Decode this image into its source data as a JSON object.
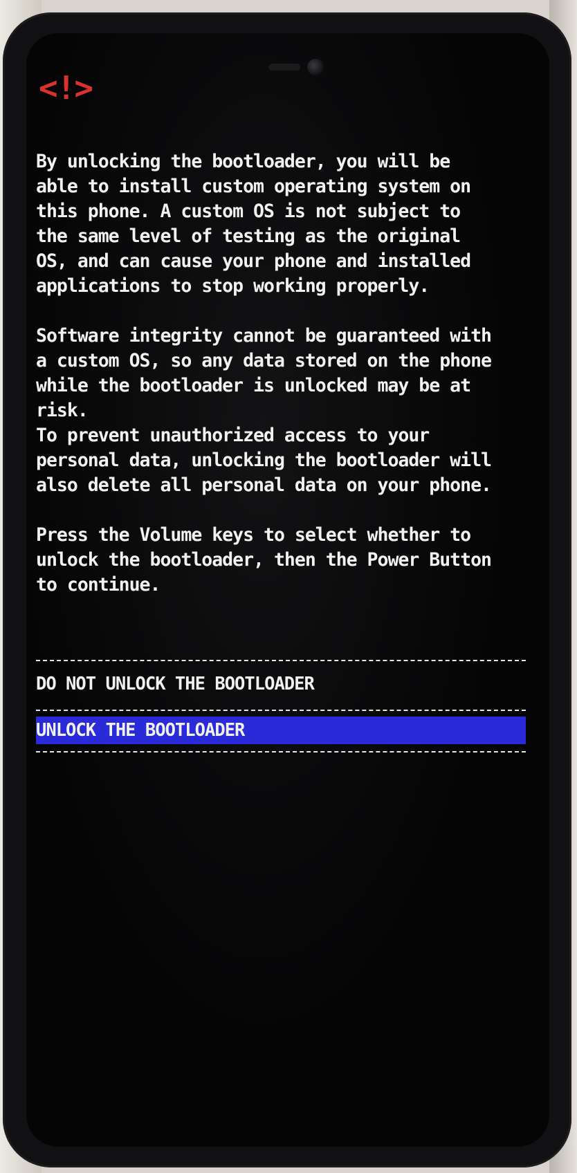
{
  "screen": {
    "warning_logo": "<!>",
    "paragraphs": [
      "By unlocking the bootloader, you will be\nable to install custom operating system on\nthis phone. A custom OS is not subject to\nthe same level of testing as the original\nOS, and can cause your phone and installed\napplications to stop working properly.",
      "Software integrity cannot be guaranteed with\na custom OS, so any data stored on the phone\nwhile the bootloader is unlocked may be at\nrisk.\nTo prevent unauthorized access to your\npersonal data, unlocking the bootloader will\nalso delete all personal data on your phone.",
      "Press the Volume keys to select whether to\nunlock the bootloader, then the Power Button\nto continue."
    ]
  },
  "menu": {
    "options": [
      {
        "label": "DO NOT UNLOCK THE BOOTLOADER",
        "selected": false
      },
      {
        "label": "UNLOCK THE BOOTLOADER",
        "selected": true
      }
    ]
  },
  "colors": {
    "warning": "#d8322e",
    "selection": "#2a2ad8",
    "text": "#f1f1ef",
    "background": "#050506"
  }
}
